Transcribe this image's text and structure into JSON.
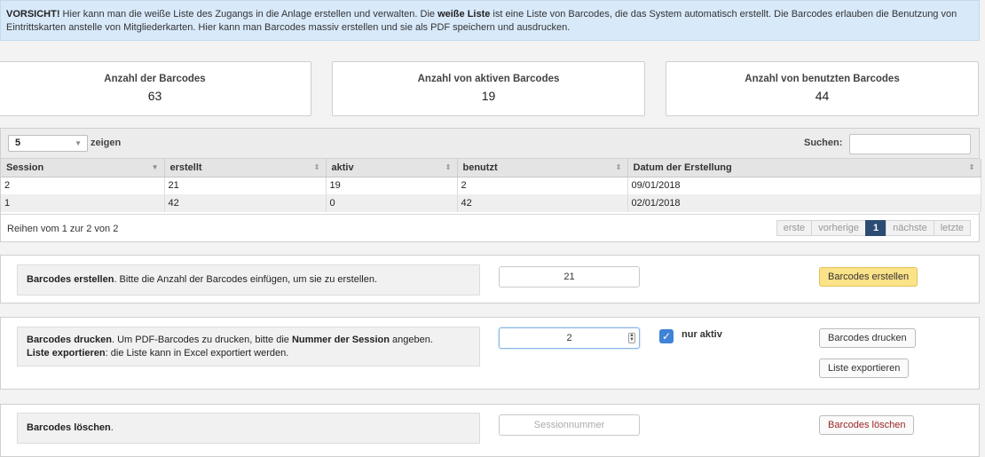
{
  "alert": {
    "strong1": "VORSICHT!",
    "text1": " Hier kann man die weiße Liste des Zugangs in die Anlage erstellen und verwalten. Die ",
    "strong2": "weiße Liste",
    "text2": " ist eine Liste von Barcodes, die das System automatisch erstellt. Die Barcodes erlauben die Benutzung von Eintrittskarten anstelle von Mitgliederkarten. Hier kann man Barcodes massiv erstellen und sie als PDF speichern und ausdrucken."
  },
  "stats": [
    {
      "label": "Anzahl der Barcodes",
      "value": "63"
    },
    {
      "label": "Anzahl von aktiven Barcodes",
      "value": "19"
    },
    {
      "label": "Anzahl von benutzten Barcodes",
      "value": "44"
    }
  ],
  "table": {
    "length_value": "5",
    "length_suffix": "zeigen",
    "search_label": "Suchen:",
    "search_value": "",
    "columns": [
      "Session",
      "erstellt",
      "aktiv",
      "benutzt",
      "Datum der Erstellung"
    ],
    "rows": [
      [
        "2",
        "21",
        "19",
        "2",
        "09/01/2018"
      ],
      [
        "1",
        "42",
        "0",
        "42",
        "02/01/2018"
      ]
    ],
    "info": "Reihen vom 1 zur 2 von 2",
    "pager": {
      "first": "erste",
      "prev": "vorherige",
      "current": "1",
      "next": "nächste",
      "last": "letzte"
    }
  },
  "create": {
    "desc_bold": "Barcodes erstellen",
    "desc_text": ". Bitte die Anzahl der Barcodes einfügen, um sie zu erstellen.",
    "input_value": "21",
    "button": "Barcodes erstellen"
  },
  "print": {
    "line1_bold": "Barcodes drucken",
    "line1_text": ". Um PDF-Barcodes zu drucken, bitte die ",
    "line1_bold2": "Nummer der Session",
    "line1_text2": " angeben.",
    "line2_bold": "Liste exportieren",
    "line2_text": ": die Liste kann in Excel exportiert werden.",
    "input_value": "2",
    "checkbox_label": "nur aktiv",
    "checkbox_checked": true,
    "print_button": "Barcodes drucken",
    "export_button": "Liste exportieren"
  },
  "delete": {
    "desc_bold": "Barcodes löschen",
    "desc_text": ".",
    "input_placeholder": "Sessionnummer",
    "button": "Barcodes löschen"
  }
}
